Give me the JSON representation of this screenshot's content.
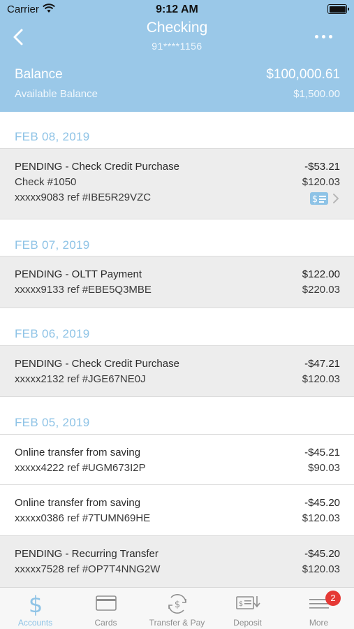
{
  "status_bar": {
    "carrier": "Carrier",
    "time": "9:12 AM"
  },
  "nav": {
    "title": "Checking",
    "account_number": "91****1156"
  },
  "balance": {
    "label": "Balance",
    "value": "$100,000.61",
    "available_label": "Available Balance",
    "available_value": "$1,500.00"
  },
  "sections": [
    {
      "date": "FEB 08, 2019",
      "transactions": [
        {
          "title": "PENDING - Check Credit Purchase",
          "line2": "Check #1050",
          "line3": "xxxxx9083 ref #IBE5R29VZC",
          "amount": "-$53.21",
          "balance": "$120.03"
        }
      ]
    },
    {
      "date": "FEB 07, 2019",
      "transactions": [
        {
          "title": "PENDING - OLTT Payment",
          "line2": "xxxxx9133 ref #EBE5Q3MBE",
          "amount": "$122.00",
          "balance": "$220.03"
        }
      ]
    },
    {
      "date": "FEB 06, 2019",
      "transactions": [
        {
          "title": "PENDING - Check Credit Purchase",
          "line2": "xxxxx2132 ref #JGE67NE0J",
          "amount": "-$47.21",
          "balance": "$120.03"
        }
      ]
    },
    {
      "date": "FEB 05, 2019",
      "transactions": [
        {
          "title": "Online transfer from saving",
          "line2": "xxxxx4222 ref #UGM673I2P",
          "amount": "-$45.21",
          "balance": "$90.03"
        },
        {
          "title": "Online transfer from saving",
          "line2": "xxxxx0386 ref #7TUMN69HE",
          "amount": "-$45.20",
          "balance": "$120.03"
        },
        {
          "title": "PENDING - Recurring Transfer",
          "line2": "xxxxx7528 ref #OP7T4NNG2W",
          "amount": "-$45.20",
          "balance": "$120.03"
        }
      ]
    }
  ],
  "tabs": [
    {
      "label": "Accounts",
      "icon": "dollar-icon"
    },
    {
      "label": "Cards",
      "icon": "card-icon"
    },
    {
      "label": "Transfer & Pay",
      "icon": "transfer-icon"
    },
    {
      "label": "Deposit",
      "icon": "deposit-icon"
    },
    {
      "label": "More",
      "icon": "menu-icon",
      "badge": "2"
    }
  ],
  "colors": {
    "header": "#9ac8e8",
    "accent": "#8ec3e6",
    "badge": "#e53935"
  }
}
